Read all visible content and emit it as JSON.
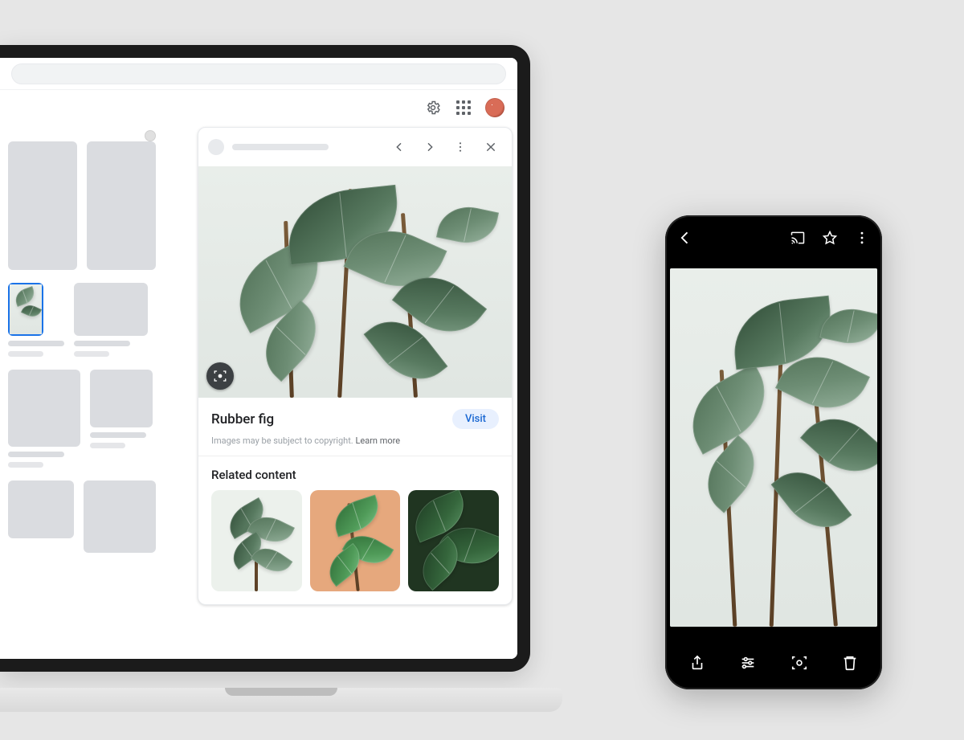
{
  "desktop": {
    "panel": {
      "title": "Rubber fig",
      "visit_label": "Visit",
      "copyright_note": "Images may be subject to copyright.",
      "learn_more_label": "Learn more",
      "related_heading": "Related content"
    }
  },
  "phone": {
    "icons": {
      "back": "back-icon",
      "cast": "cast-icon",
      "favorite": "star-outline-icon",
      "more": "more-vert-icon",
      "share": "share-icon",
      "edit": "edit-sliders-icon",
      "lens": "lens-icon",
      "delete": "trash-icon"
    }
  }
}
